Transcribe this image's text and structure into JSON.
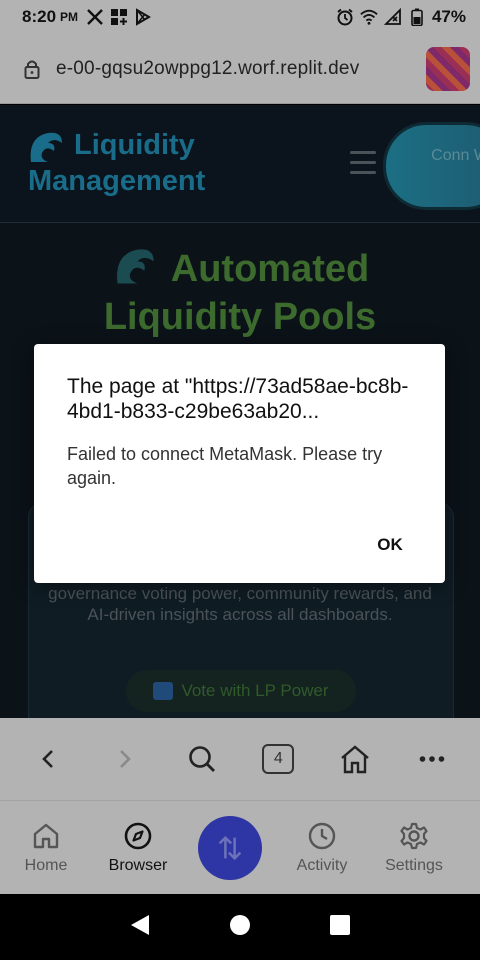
{
  "status_bar": {
    "time": "8:20",
    "ampm": "PM",
    "battery": "47%"
  },
  "url_bar": {
    "url": "e-00-gqsu2owppg12.worf.replit.dev"
  },
  "site": {
    "brand_line1": "Liquidity",
    "brand_line2": "Management",
    "connect_wallet": "Conn Wal",
    "hero_title_line1": "Automated",
    "hero_title_line2": "Liquidity Pools",
    "card_text": "governance voting power, community rewards, and AI-driven insights across all dashboards.",
    "vote_button": "Vote with LP Power"
  },
  "browser_toolbar": {
    "tab_count": "4"
  },
  "bottom_nav": {
    "items": [
      {
        "label": "Home",
        "icon": "home-icon"
      },
      {
        "label": "Browser",
        "icon": "compass-icon"
      },
      {
        "label": "",
        "icon": "swap-icon"
      },
      {
        "label": "Activity",
        "icon": "clock-icon"
      },
      {
        "label": "Settings",
        "icon": "gear-icon"
      }
    ]
  },
  "dialog": {
    "title": "The page at \"https://73ad58ae-bc8b-4bd1-b833-c29be63ab20...",
    "message": "Failed to connect MetaMask. Please try again.",
    "ok_label": "OK"
  },
  "colors": {
    "swap_fab": "#2e35a4",
    "brand_text": "#1a6d8a",
    "hero_text": "#3d6b2e",
    "chrome_grey": "#b3b3b3"
  }
}
